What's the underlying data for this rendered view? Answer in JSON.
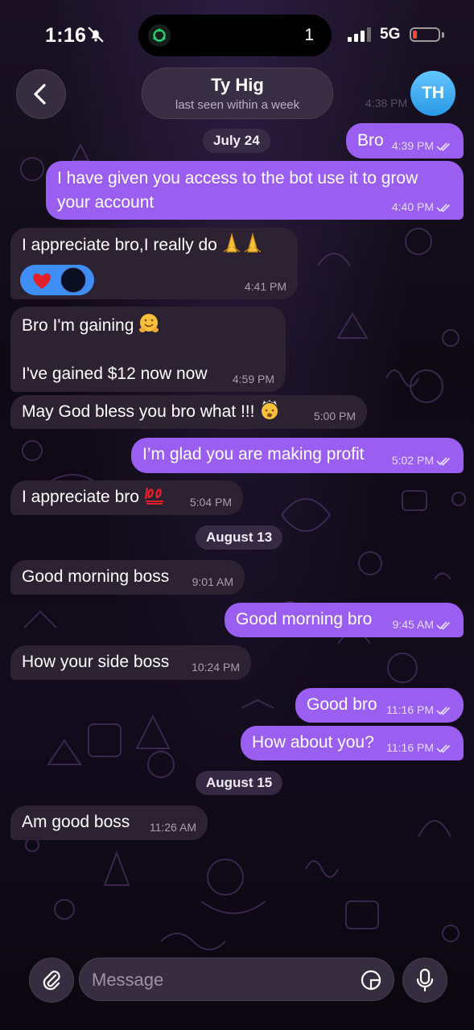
{
  "status_bar": {
    "time": "1:16",
    "island_count": "1",
    "network": "5G"
  },
  "header": {
    "contact_name": "Ty Hig",
    "last_seen": "last seen within a week",
    "avatar_initials": "TH",
    "partially_hidden_time": "4:38 PM"
  },
  "dates": [
    "July 24",
    "August 13",
    "August 15"
  ],
  "messages": [
    {
      "dir": "out",
      "text": "Bro",
      "time": "4:39 PM",
      "read": true
    },
    {
      "dir": "out",
      "text": "I have given you access to the bot use it to grow your account",
      "line1": "I have given you access to the bot use it to grow",
      "line2": "your account",
      "time": "4:40 PM",
      "read": true
    },
    {
      "dir": "in",
      "text": "I appreciate bro,I really do",
      "emoji": "folded-hands x2",
      "time": "4:41 PM",
      "reactions": [
        "red-heart",
        "support-avatar"
      ]
    },
    {
      "dir": "in",
      "line1": "Bro I'm gaining",
      "emoji": "hugging-face",
      "line2": "I've gained $12 now now",
      "time": "4:59 PM"
    },
    {
      "dir": "in",
      "text": "May God bless you bro what !!!",
      "emoji": "exploding-head",
      "time": "5:00 PM"
    },
    {
      "dir": "out",
      "text": "I’m glad you are making profit",
      "time": "5:02 PM",
      "read": true
    },
    {
      "dir": "in",
      "text": "I appreciate bro",
      "emoji": "hundred-points",
      "time": "5:04 PM"
    },
    {
      "dir": "in",
      "text": "Good morning boss",
      "time": "9:01 AM"
    },
    {
      "dir": "out",
      "text": "Good morning bro",
      "time": "9:45 AM",
      "read": true
    },
    {
      "dir": "in",
      "text": "How your side boss",
      "time": "10:24 PM"
    },
    {
      "dir": "out",
      "text": "Good bro",
      "time": "11:16 PM",
      "read": true
    },
    {
      "dir": "out",
      "text": "How about you?",
      "time": "11:16 PM",
      "read": true
    },
    {
      "dir": "in",
      "text": "Am good boss",
      "time": "11:26 AM"
    }
  ],
  "input": {
    "placeholder": "Message"
  },
  "icons": [
    "back-chevron-icon",
    "attach-paperclip-icon",
    "sticker-icon",
    "microphone-icon",
    "double-check-icon",
    "silent-bell-icon"
  ],
  "colors": {
    "outgoing_bubble": "#9a5ef0",
    "incoming_bubble": "#2d2231",
    "avatar": "#3aa8f0",
    "reaction_bg": "#3e8ef5"
  }
}
